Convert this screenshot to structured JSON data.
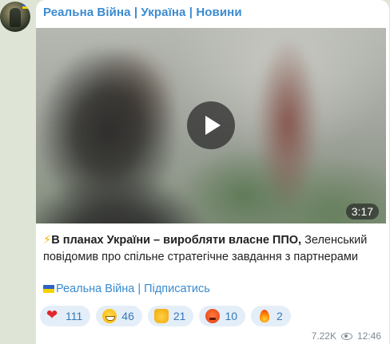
{
  "channel": {
    "title": "Реальна Війна | Україна | Новини"
  },
  "video": {
    "duration": "3:17",
    "play_icon": "play-icon"
  },
  "post": {
    "bold_text": "В планах України – виробляти власне ППО,",
    "text": " Зеленський повідомив про спільне стратегічне завдання з партнерами",
    "lead_icon": "lightning-icon"
  },
  "subscribe": {
    "channel_link": "Реальна Війна",
    "separator": " | ",
    "subscribe_link": "Підписатись",
    "flag_icon": "ukraine-flag-icon"
  },
  "reactions": [
    {
      "emoji": "heart",
      "count": "111"
    },
    {
      "emoji": "grinning-face",
      "count": "46"
    },
    {
      "emoji": "thumbs-up",
      "count": "21"
    },
    {
      "emoji": "angry-face",
      "count": "10"
    },
    {
      "emoji": "fire",
      "count": "2"
    }
  ],
  "meta": {
    "views": "7.22K",
    "time": "12:46"
  },
  "colors": {
    "accent": "#3a8bd0",
    "background": "#dfe5d6",
    "reaction_bg": "#e4eef8"
  }
}
